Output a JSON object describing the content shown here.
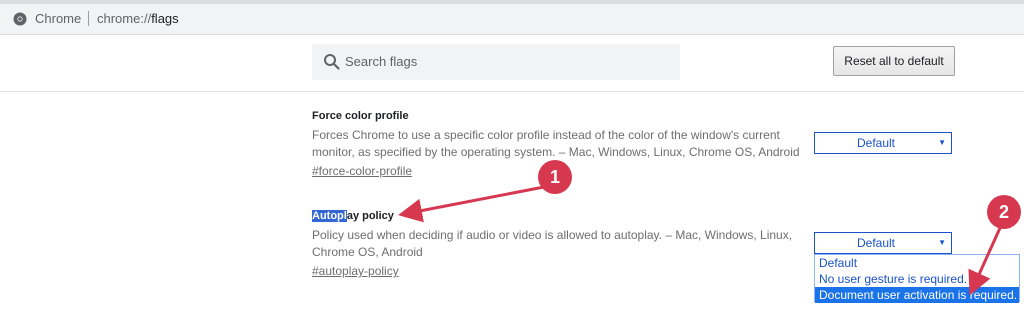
{
  "omnibox": {
    "label": "Chrome",
    "url_scheme": "chrome://",
    "url_host": "flags"
  },
  "header": {
    "search_placeholder": "Search flags",
    "reset_label": "Reset all to default"
  },
  "flags": [
    {
      "title": "Force color profile",
      "description": "Forces Chrome to use a specific color profile instead of the color of the window's current monitor, as specified by the operating system. – Mac, Windows, Linux, Chrome OS, Android",
      "link": "#force-color-profile",
      "selected": "Default"
    },
    {
      "title_highlight": "Autopl",
      "title_rest": "ay policy",
      "description": "Policy used when deciding if audio or video is allowed to autoplay. – Mac, Windows, Linux, Chrome OS, Android",
      "link": "#autoplay-policy",
      "selected": "Default",
      "options": [
        "Default",
        "No user gesture is required.",
        "Document user activation is required."
      ],
      "highlighted_option": "Document user activation is required."
    }
  ],
  "annotations": {
    "badge1": "1",
    "badge2": "2",
    "color": "#d6394f"
  },
  "colors": {
    "accent_blue": "#1a73e8",
    "select_border": "#1a53c9"
  }
}
